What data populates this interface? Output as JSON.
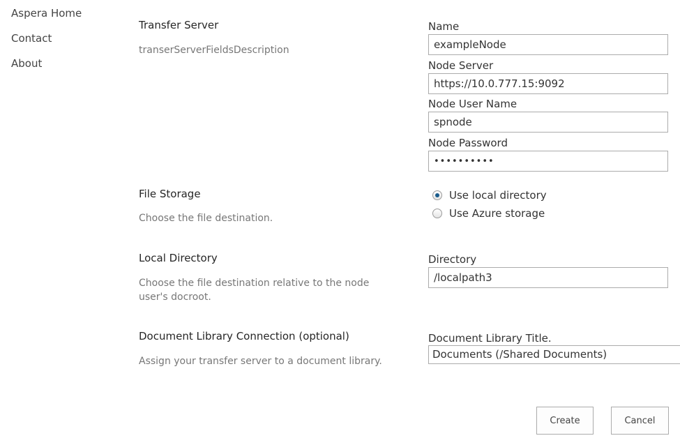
{
  "nav": {
    "items": [
      {
        "label": "Aspera Home"
      },
      {
        "label": "Contact"
      },
      {
        "label": "About"
      }
    ]
  },
  "sections": {
    "transfer_server": {
      "title": "Transfer Server",
      "description": "transerServerFieldsDescription"
    },
    "file_storage": {
      "title": "File Storage",
      "description": "Choose the file destination."
    },
    "local_directory": {
      "title": "Local Directory",
      "description": "Choose the file destination relative to the node user's docroot."
    },
    "doc_library": {
      "title": "Document Library Connection (optional)",
      "description": "Assign your transfer server to a document library."
    }
  },
  "fields": {
    "name": {
      "label": "Name",
      "value": "exampleNode"
    },
    "node_server": {
      "label": "Node Server",
      "value": "https://10.0.777.15:9092"
    },
    "node_user_name": {
      "label": "Node User Name",
      "value": "spnode"
    },
    "node_password": {
      "label": "Node Password",
      "value": "••••••••••"
    },
    "directory": {
      "label": "Directory",
      "value": "/localpath3"
    },
    "doc_library_title": {
      "label": "Document Library Title.",
      "selected": "Documents (/Shared Documents)"
    }
  },
  "storage_options": [
    {
      "label": "Use local directory",
      "checked": true
    },
    {
      "label": "Use Azure storage",
      "checked": false
    }
  ],
  "buttons": {
    "create": "Create",
    "cancel": "Cancel"
  }
}
